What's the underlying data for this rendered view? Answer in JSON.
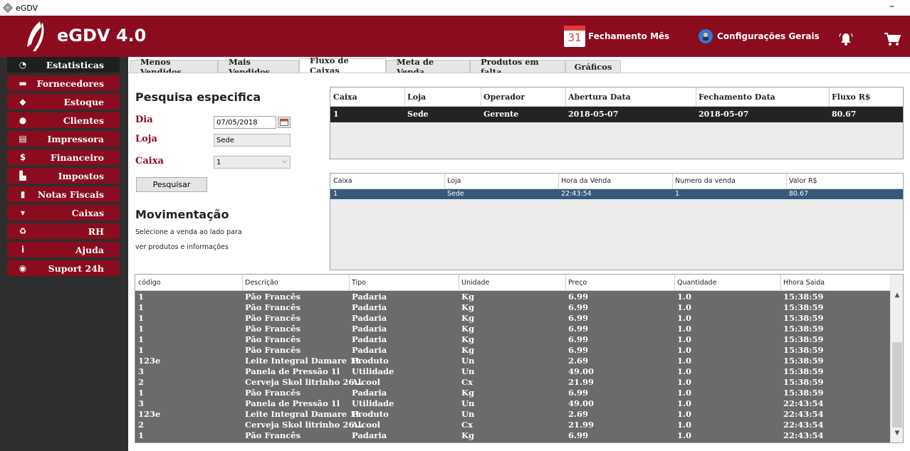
{
  "window": {
    "title": "eGDV",
    "minimize_glyph": "–"
  },
  "header": {
    "app_name": "eGDV 4.0",
    "calendar_day": "31",
    "fechamento_label": "Fechamento Mês",
    "config_label": "Configurações Gerais",
    "brand_color": "#8b0b1f"
  },
  "sidebar": {
    "items": [
      {
        "label": "Estatisticas",
        "icon": "chart-icon",
        "glyph": "◔"
      },
      {
        "label": "Fornecedores",
        "icon": "truck-icon",
        "glyph": "▬"
      },
      {
        "label": "Estoque",
        "icon": "box-icon",
        "glyph": "◆"
      },
      {
        "label": "Clientes",
        "icon": "user-icon",
        "glyph": "●"
      },
      {
        "label": "Impressora",
        "icon": "printer-icon",
        "glyph": "▤"
      },
      {
        "label": "Financeiro",
        "icon": "dollar-icon",
        "glyph": "$"
      },
      {
        "label": "Impostos",
        "icon": "tax-document-icon",
        "glyph": "▙"
      },
      {
        "label": "Notas Fiscais",
        "icon": "document-icon",
        "glyph": "▮"
      },
      {
        "label": "Caixas",
        "icon": "cart-icon",
        "glyph": "▾"
      },
      {
        "label": "RH",
        "icon": "people-icon",
        "glyph": "♻"
      },
      {
        "label": "Ajuda",
        "icon": "info-icon",
        "glyph": "i"
      },
      {
        "label": "Suport 24h",
        "icon": "support-icon",
        "glyph": "◉"
      }
    ]
  },
  "tabs": [
    {
      "label": "Menos Vendidos"
    },
    {
      "label": "Mais Vendidos"
    },
    {
      "label": "Fluxo de Caixas"
    },
    {
      "label": "Meta de Venda"
    },
    {
      "label": "Produtos em falta"
    },
    {
      "label": "Gráficos"
    }
  ],
  "form": {
    "title": "Pesquisa especifica",
    "dia_label": "Dia",
    "dia_value": "07/05/2018",
    "loja_label": "Loja",
    "loja_value": "Sede",
    "caixa_label": "Caixa",
    "caixa_value": "1",
    "search_button": "Pesquisar",
    "mov_title": "Movimentação",
    "mov_line1": "Selecione a venda ao lado para",
    "mov_line2": "ver produtos e informações"
  },
  "table1": {
    "headers": [
      "Caixa",
      "Loja",
      "Operador",
      "Abertura Data",
      "Fechamento Data",
      "Fluxo R$"
    ],
    "rows": [
      [
        "1",
        "Sede",
        "Gerente",
        "2018-05-07",
        "2018-05-07",
        "80.67"
      ]
    ]
  },
  "table2": {
    "headers": [
      "Caixa",
      "Loja",
      "Hora da Venda",
      "Numero da venda",
      "Valor R$"
    ],
    "rows": [
      [
        "1",
        "Sede",
        "22:43:54",
        "1",
        "80.67"
      ]
    ]
  },
  "table3": {
    "headers": [
      "código",
      "Descrição",
      "Tipo",
      "Unidade",
      "Preço",
      "Quantidade",
      "Hhora Saida"
    ],
    "rows": [
      [
        "1",
        "Pão Francês",
        "Padaria",
        "Kg",
        "6.99",
        "1.0",
        "15:38:59"
      ],
      [
        "1",
        "Pão Francês",
        "Padaria",
        "Kg",
        "6.99",
        "1.0",
        "15:38:59"
      ],
      [
        "1",
        "Pão Francês",
        "Padaria",
        "Kg",
        "6.99",
        "1.0",
        "15:38:59"
      ],
      [
        "1",
        "Pão Francês",
        "Padaria",
        "Kg",
        "6.99",
        "1.0",
        "15:38:59"
      ],
      [
        "1",
        "Pão Francês",
        "Padaria",
        "Kg",
        "6.99",
        "1.0",
        "15:38:59"
      ],
      [
        "1",
        "Pão Francês",
        "Padaria",
        "Kg",
        "6.99",
        "1.0",
        "15:38:59"
      ],
      [
        "123e",
        "Leite Integral Damare 1L",
        "Produto",
        "Un",
        "2.69",
        "1.0",
        "15:38:59"
      ],
      [
        "3",
        "Panela de Pressão 1l",
        "Utilidade",
        "Un",
        "49.00",
        "1.0",
        "15:38:59"
      ],
      [
        "2",
        "Cerveja Skol litrinho 26...",
        "Alcool",
        "Cx",
        "21.99",
        "1.0",
        "15:38:59"
      ],
      [
        "1",
        "Pão Francês",
        "Padaria",
        "Kg",
        "6.99",
        "1.0",
        "15:38:59"
      ],
      [
        "3",
        "Panela de Pressão 1l",
        "Utilidade",
        "Un",
        "49.00",
        "1.0",
        "22:43:54"
      ],
      [
        "123e",
        "Leite Integral Damare 1L",
        "Produto",
        "Un",
        "2.69",
        "1.0",
        "22:43:54"
      ],
      [
        "2",
        "Cerveja Skol litrinho 26...",
        "Alcool",
        "Cx",
        "21.99",
        "1.0",
        "22:43:54"
      ],
      [
        "1",
        "Pão Francês",
        "Padaria",
        "Kg",
        "6.99",
        "1.0",
        "22:43:54"
      ]
    ]
  }
}
